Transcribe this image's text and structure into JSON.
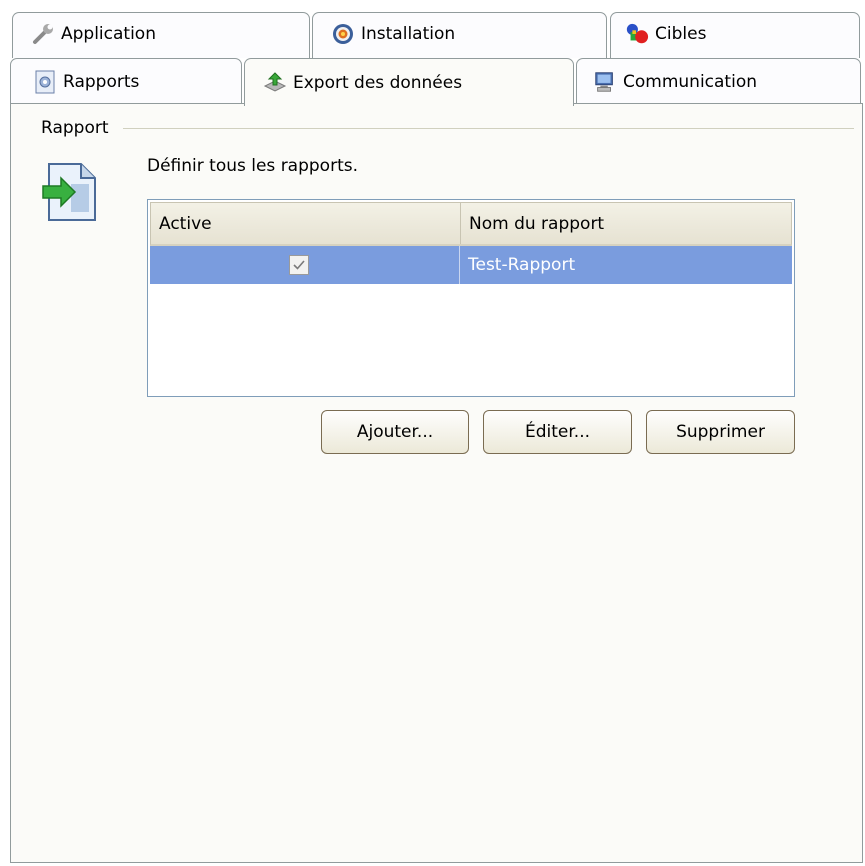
{
  "tabs": {
    "row1": [
      {
        "label": "Application",
        "icon": "wrench-icon"
      },
      {
        "label": "Installation",
        "icon": "target-icon"
      },
      {
        "label": "Cibles",
        "icon": "shapes-icon"
      }
    ],
    "row2": [
      {
        "label": "Rapports",
        "icon": "report-icon"
      },
      {
        "label": "Export des données",
        "icon": "export-icon",
        "active": true
      },
      {
        "label": "Communication",
        "icon": "computer-icon"
      }
    ]
  },
  "group": {
    "title": "Rapport",
    "description": "Définir tous les rapports.",
    "icon": "document-arrow-icon"
  },
  "list": {
    "columns": [
      "Active",
      "Nom du rapport"
    ],
    "rows": [
      {
        "active": true,
        "name": "Test-Rapport",
        "selected": true
      }
    ]
  },
  "buttons": {
    "add": "Ajouter...",
    "edit": "Éditer...",
    "delete": "Supprimer"
  },
  "colors": {
    "selection": "#7a9cde",
    "panel": "#fbfbf8",
    "border": "#919b9c"
  }
}
